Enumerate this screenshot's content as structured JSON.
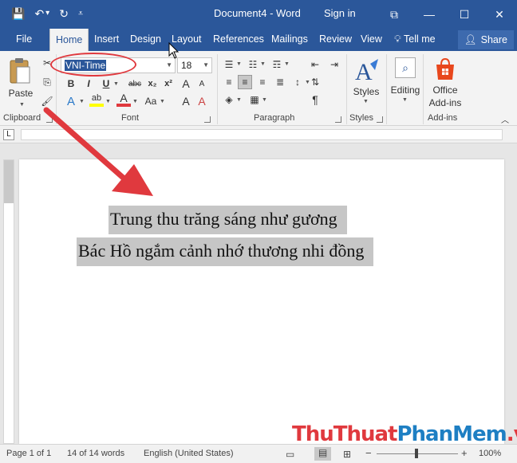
{
  "titlebar": {
    "doc_title": "Document4  -  Word",
    "sign_in": "Sign in",
    "qat": {
      "save": "💾",
      "undo": "↶",
      "undo_dd": "▾",
      "redo": "↻",
      "customize": "⩡"
    },
    "controls": {
      "ribbon_opts": "⧉",
      "minimize": "—",
      "maximize": "☐",
      "close": "✕"
    }
  },
  "tabs": [
    "File",
    "Home",
    "Insert",
    "Design",
    "Layout",
    "References",
    "Mailings",
    "Review",
    "View"
  ],
  "tell_me": "Tell me",
  "share": "Share",
  "ribbon": {
    "clipboard": {
      "label": "Clipboard",
      "paste": "Paste"
    },
    "font": {
      "label": "Font",
      "font_name": "VNI-Time",
      "font_size": "18",
      "bold": "B",
      "italic": "I",
      "underline": "U",
      "strike": "abc",
      "subscript": "x₂",
      "superscript": "x²",
      "text_effects": "A",
      "highlight": "ab",
      "font_color": "A",
      "grow": "A",
      "shrink": "A",
      "change_case": "Aa",
      "clear": "A"
    },
    "paragraph": {
      "label": "Paragraph",
      "show_marks": "¶"
    },
    "styles": {
      "label": "Styles",
      "button": "Styles"
    },
    "editing": {
      "button": "Editing"
    },
    "addins": {
      "label": "Add-ins",
      "button_line1": "Office",
      "button_line2": "Add-ins"
    }
  },
  "document": {
    "lines": [
      "Trung thu trăng sáng như gương",
      "Bác Hồ ngắm cảnh nhớ thương nhi đồng"
    ]
  },
  "status": {
    "page": "Page 1 of 1",
    "words": "14 of 14 words",
    "language": "English (United States)",
    "zoom": "100%"
  },
  "watermark": {
    "part1": "ThuThuat",
    "part2": "PhanMem",
    "part3": ".vn"
  },
  "colors": {
    "accent": "#2b579a",
    "annotation": "#e0393e",
    "watermark_red": "#e0393e",
    "watermark_blue": "#1e7fc3"
  }
}
